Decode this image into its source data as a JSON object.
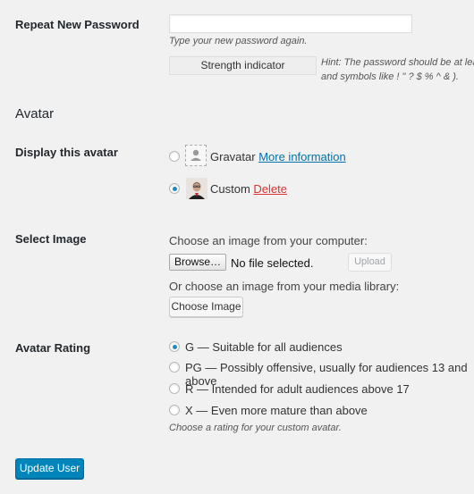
{
  "password": {
    "repeat_label": "Repeat New Password",
    "repeat_description": "Type your new password again.",
    "strength_indicator": "Strength indicator",
    "hint_line1": "Hint: The password should be at lea",
    "hint_line2": "and symbols like ! \" ? $ % ^ & )."
  },
  "avatar": {
    "section_title": "Avatar",
    "display_label": "Display this avatar",
    "options": [
      {
        "label": "Gravatar",
        "link": "More information",
        "checked": false
      },
      {
        "label": "Custom",
        "link": "Delete",
        "checked": true
      }
    ]
  },
  "select_image": {
    "label": "Select Image",
    "computer_prompt": "Choose an image from your computer:",
    "browse_button": "Browse…",
    "file_status": "No file selected.",
    "upload_button": "Upload",
    "library_prompt": "Or choose an image from your media library:",
    "choose_button": "Choose Image"
  },
  "rating": {
    "label": "Avatar Rating",
    "options": [
      {
        "label": "G — Suitable for all audiences",
        "checked": true
      },
      {
        "label": "PG — Possibly offensive, usually for audiences 13 and above",
        "checked": false
      },
      {
        "label": "R — Intended for adult audiences above 17",
        "checked": false
      },
      {
        "label": "X — Even more mature than above",
        "checked": false
      }
    ],
    "description": "Choose a rating for your custom avatar."
  },
  "actions": {
    "update_button": "Update User"
  },
  "colors": {
    "background": "#f1f1f1",
    "link": "#0073aa",
    "delete_link": "#dc3232",
    "primary_button": "#0085ba",
    "radio_checked": "#1e8cbe"
  }
}
